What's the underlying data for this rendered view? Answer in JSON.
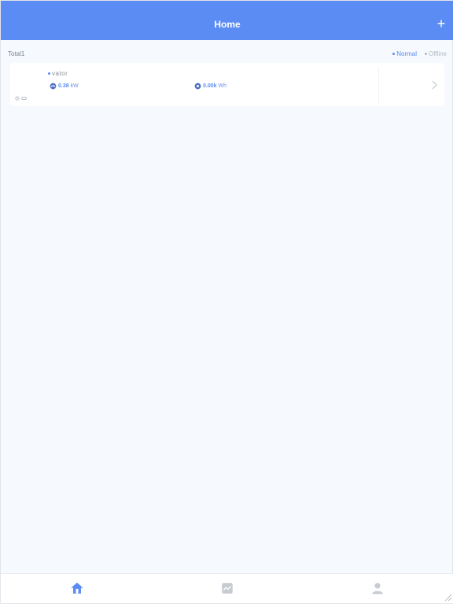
{
  "header": {
    "title": "Home",
    "add_label": "+"
  },
  "summary": {
    "total_label": "Total1",
    "legend": [
      {
        "label": "Normal",
        "color": "#5b8cf4"
      },
      {
        "label": "Offline",
        "color": "#b5bac4"
      }
    ]
  },
  "devices": [
    {
      "name": "vator",
      "status_color": "#5b8cf4",
      "power_value": "0.38",
      "power_unit": "kW",
      "energy_value": "0.00k",
      "energy_unit": "Wh",
      "icons": [
        "signal-icon",
        "link-icon"
      ]
    }
  ],
  "tabbar": {
    "tabs": [
      {
        "name": "home",
        "icon": "home-icon",
        "active": true
      },
      {
        "name": "chart",
        "icon": "chart-icon",
        "active": false
      },
      {
        "name": "profile",
        "icon": "user-icon",
        "active": false
      }
    ]
  },
  "colors": {
    "accent": "#5b8cf4",
    "inactive": "#c7cbd2"
  }
}
